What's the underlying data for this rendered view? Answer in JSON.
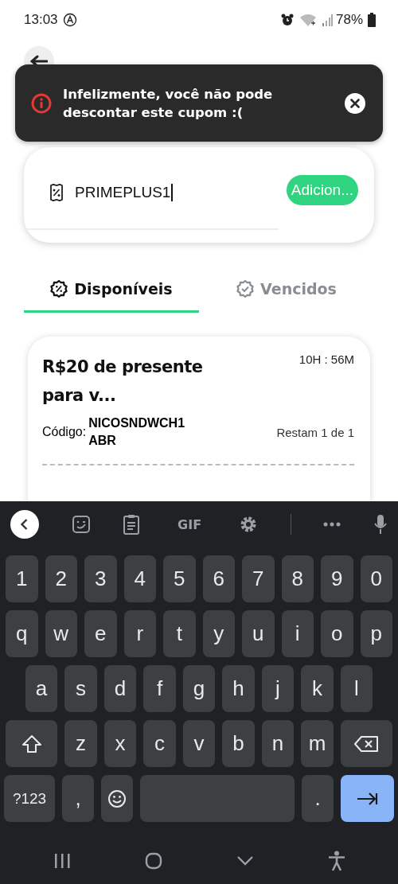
{
  "status_bar": {
    "time": "13:03",
    "battery": "78%"
  },
  "toast": {
    "message": "Infelizmente, você não pode descontar este cupom :("
  },
  "coupon_input": {
    "value": "PRIMEPLUS1",
    "button": "Adicion..."
  },
  "tabs": [
    {
      "label": "Disponíveis",
      "selected": true
    },
    {
      "label": "Vencidos",
      "selected": false
    }
  ],
  "coupons": [
    {
      "title": "R$20 de presente para v...",
      "timer": "10H : 56M",
      "code_label": "Código:",
      "code": "NICOSNDWCH1ABR",
      "remaining": "Restam 1 de 1"
    }
  ],
  "keyboard": {
    "toolbar": [
      {
        "kind": "collapse"
      },
      {
        "kind": "sticker"
      },
      {
        "kind": "clipboard"
      },
      {
        "kind": "text",
        "label": "GIF"
      },
      {
        "kind": "settings"
      },
      {
        "kind": "divider"
      },
      {
        "kind": "more"
      },
      {
        "kind": "mic"
      }
    ],
    "rows": [
      [
        {
          "kind": "char",
          "label": "1"
        },
        {
          "kind": "char",
          "label": "2"
        },
        {
          "kind": "char",
          "label": "3"
        },
        {
          "kind": "char",
          "label": "4"
        },
        {
          "kind": "char",
          "label": "5"
        },
        {
          "kind": "char",
          "label": "6"
        },
        {
          "kind": "char",
          "label": "7"
        },
        {
          "kind": "char",
          "label": "8"
        },
        {
          "kind": "char",
          "label": "9"
        },
        {
          "kind": "char",
          "label": "0"
        }
      ],
      [
        {
          "kind": "char",
          "label": "q"
        },
        {
          "kind": "char",
          "label": "w"
        },
        {
          "kind": "char",
          "label": "e"
        },
        {
          "kind": "char",
          "label": "r"
        },
        {
          "kind": "char",
          "label": "t"
        },
        {
          "kind": "char",
          "label": "y"
        },
        {
          "kind": "char",
          "label": "u"
        },
        {
          "kind": "char",
          "label": "i"
        },
        {
          "kind": "char",
          "label": "o"
        },
        {
          "kind": "char",
          "label": "p"
        }
      ],
      [
        {
          "kind": "char",
          "label": "a"
        },
        {
          "kind": "char",
          "label": "s"
        },
        {
          "kind": "char",
          "label": "d"
        },
        {
          "kind": "char",
          "label": "f"
        },
        {
          "kind": "char",
          "label": "g"
        },
        {
          "kind": "char",
          "label": "h"
        },
        {
          "kind": "char",
          "label": "j"
        },
        {
          "kind": "char",
          "label": "k"
        },
        {
          "kind": "char",
          "label": "l"
        }
      ],
      [
        {
          "kind": "shift"
        },
        {
          "kind": "char",
          "label": "z"
        },
        {
          "kind": "char",
          "label": "x"
        },
        {
          "kind": "char",
          "label": "c"
        },
        {
          "kind": "char",
          "label": "v"
        },
        {
          "kind": "char",
          "label": "b"
        },
        {
          "kind": "char",
          "label": "n"
        },
        {
          "kind": "char",
          "label": "m"
        },
        {
          "kind": "backspace"
        }
      ],
      [
        {
          "kind": "symbols",
          "label": "?123"
        },
        {
          "kind": "char",
          "label": ","
        },
        {
          "kind": "emoji"
        },
        {
          "kind": "space"
        },
        {
          "kind": "char",
          "label": "."
        },
        {
          "kind": "enter"
        }
      ]
    ]
  }
}
